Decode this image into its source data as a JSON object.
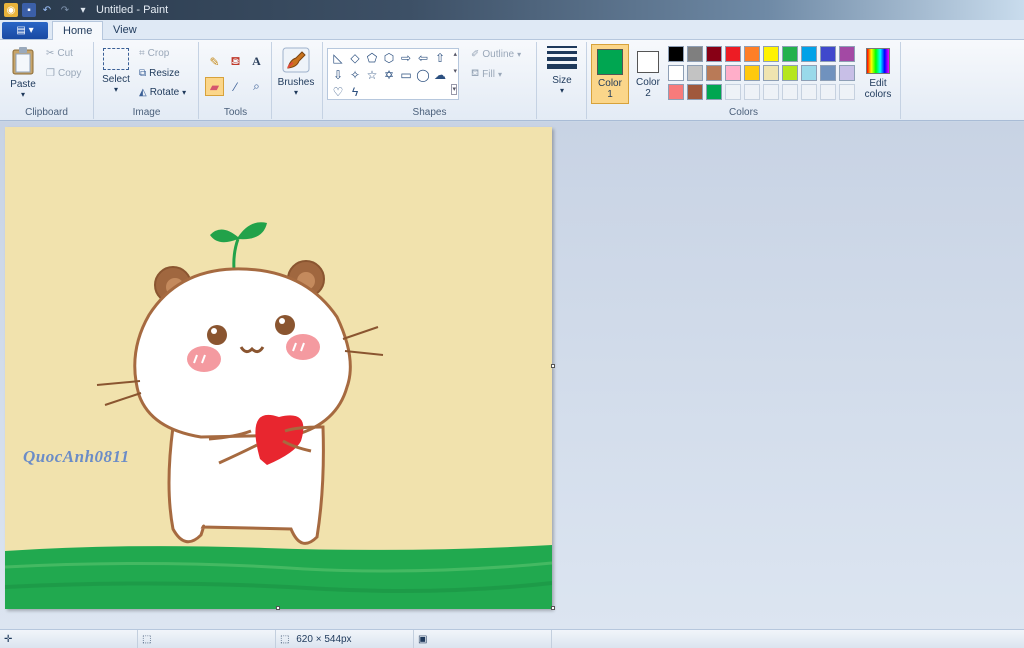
{
  "window": {
    "title": "Untitled - Paint"
  },
  "tabs": {
    "file": "▤ ▾",
    "home": "Home",
    "view": "View"
  },
  "clipboard": {
    "paste": "Paste",
    "cut": "Cut",
    "copy": "Copy",
    "label": "Clipboard"
  },
  "image": {
    "select": "Select",
    "crop": "Crop",
    "resize": "Resize",
    "rotate": "Rotate",
    "label": "Image"
  },
  "tools": {
    "label": "Tools",
    "text_glyph": "A"
  },
  "brushes": {
    "label": "Brushes"
  },
  "shapes": {
    "outline": "Outline",
    "fill": "Fill",
    "label": "Shapes"
  },
  "size": {
    "label": "Size"
  },
  "colors": {
    "color1_label": "Color",
    "color1_num": "1",
    "color2_label": "Color",
    "color2_num": "2",
    "edit_label": "Edit",
    "edit_label2": "colors",
    "label": "Colors",
    "color1": "#00a651",
    "color2": "#ffffff",
    "palette_row1": [
      "#000000",
      "#7f7f7f",
      "#880015",
      "#ed1c24",
      "#ff7f27",
      "#fff200",
      "#22b14c",
      "#00a2e8",
      "#3f48cc",
      "#a349a4"
    ],
    "palette_row2": [
      "#ffffff",
      "#c3c3c3",
      "#b97a57",
      "#ffaec9",
      "#ffc90e",
      "#efe4b0",
      "#b5e61d",
      "#99d9ea",
      "#7092be",
      "#c8bfe7"
    ],
    "palette_row3": [
      "#f77b7b",
      "#a0583c",
      "#00a651"
    ]
  },
  "canvas": {
    "watermark": "QuocAnh0811",
    "background": "#f1e2ad"
  },
  "status": {
    "dimensions": "620 × 544px"
  }
}
